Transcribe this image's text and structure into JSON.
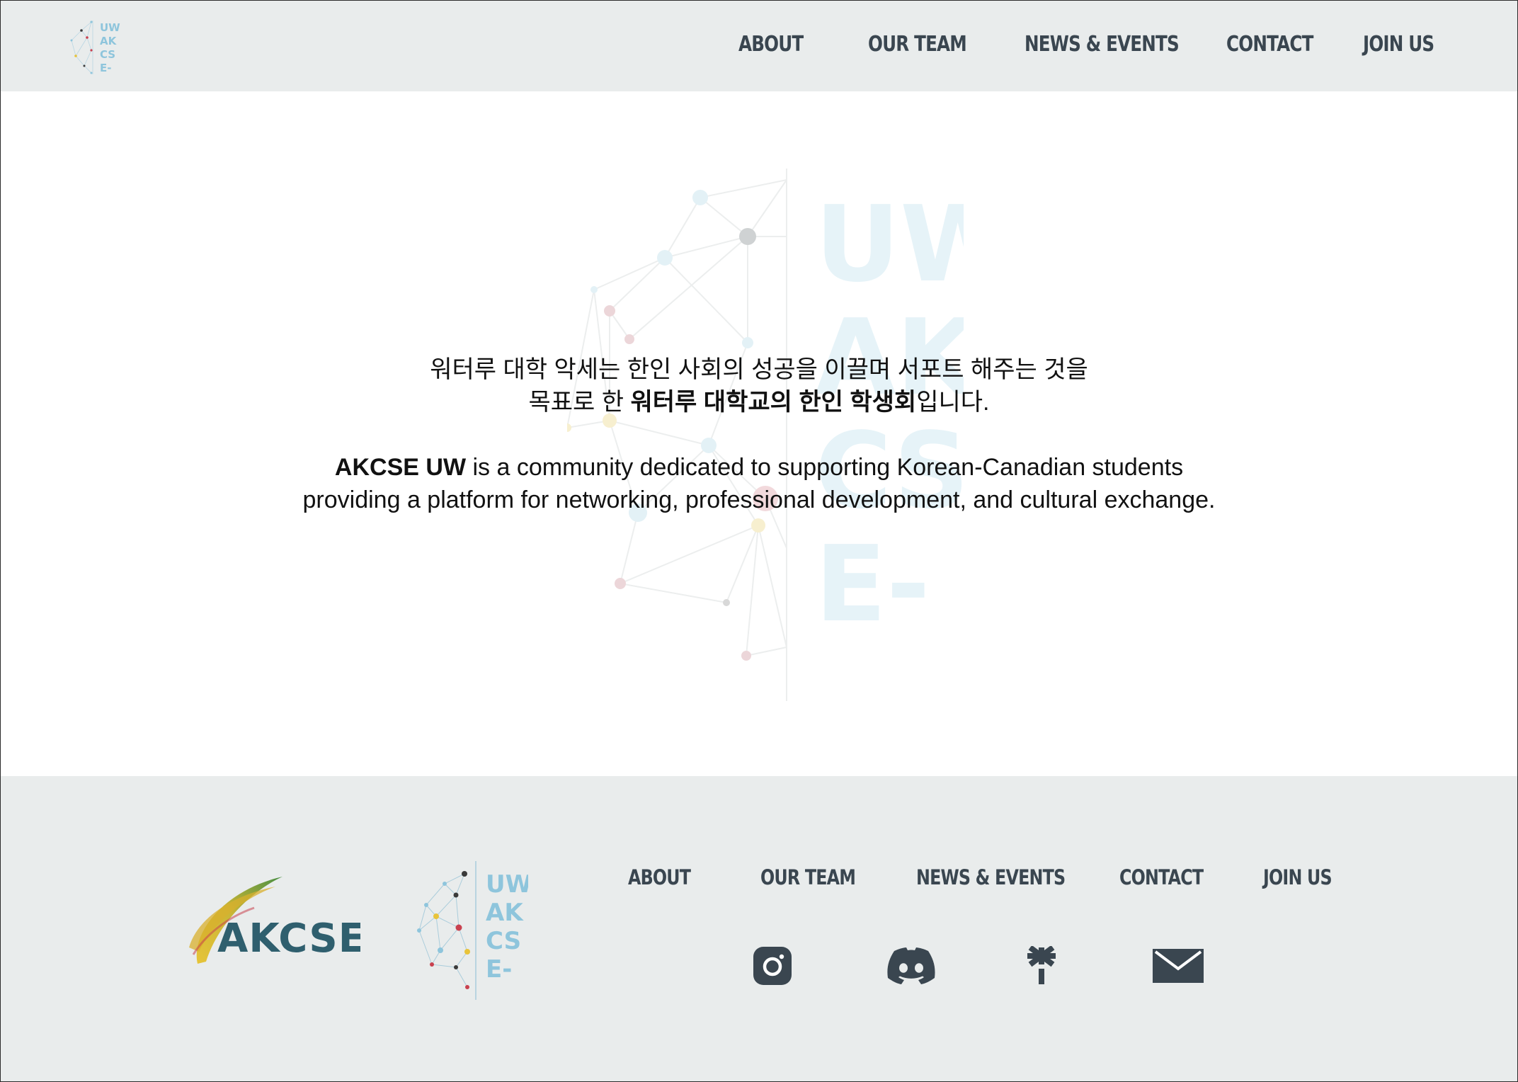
{
  "header": {
    "logo_lines": [
      "UW",
      "AK",
      "CS",
      "E-"
    ],
    "nav": [
      {
        "label": "ABOUT"
      },
      {
        "label": "OUR TEAM"
      },
      {
        "label": "NEWS & EVENTS"
      },
      {
        "label": "CONTACT"
      },
      {
        "label": "JOIN US"
      }
    ]
  },
  "hero": {
    "watermark_lines": [
      "UW",
      "AK",
      "CS",
      "E-"
    ],
    "korean_line1": "워터루 대학 악세는 한인 사회의 성공을 이끌며 서포트 해주는 것을",
    "korean_line2_prefix": "목표로 한 ",
    "korean_line2_bold": "워터루 대학교의 한인 학생회",
    "korean_line2_suffix": "입니다.",
    "english_bold": "AKCSE UW",
    "english_line1_rest": " is a community dedicated to supporting Korean-Canadian students",
    "english_line2": "providing a platform for networking, professional development, and cultural exchange."
  },
  "footer": {
    "akcse_logo_text": "AKCSE",
    "uw_logo_lines": [
      "UW",
      "AK",
      "CS",
      "E-"
    ],
    "nav": [
      {
        "label": "ABOUT"
      },
      {
        "label": "OUR TEAM"
      },
      {
        "label": "NEWS & EVENTS"
      },
      {
        "label": "CONTACT"
      },
      {
        "label": "JOIN US"
      }
    ],
    "social_icons": [
      "instagram-icon",
      "discord-icon",
      "linktree-icon",
      "email-icon"
    ]
  },
  "colors": {
    "header_bg": "#e9ecec",
    "nav_text": "#3a4650",
    "logo_blue": "#8ec5dc",
    "icon_dark": "#3a4650",
    "accent_red": "#c9414f",
    "accent_yellow": "#e8c33a"
  }
}
